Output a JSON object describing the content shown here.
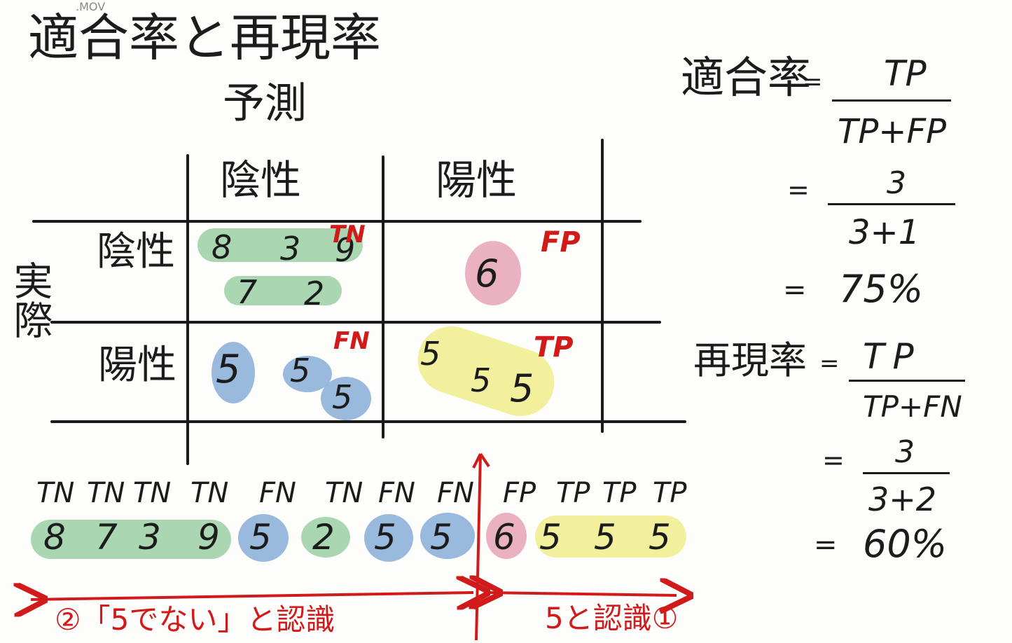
{
  "file_label": ".MOV",
  "title": "適合率と再現率",
  "predicted_header": "予測",
  "actual_header": "実際",
  "col_negative": "陰性",
  "col_positive": "陽性",
  "row_negative": "陰性",
  "row_positive": "陽性",
  "cells": {
    "tn": {
      "tag": "TN",
      "top": [
        "8",
        "3",
        "9"
      ],
      "bottom": [
        "7",
        "2"
      ]
    },
    "fp": {
      "tag": "FP",
      "values": [
        "6"
      ]
    },
    "fn": {
      "tag": "FN",
      "values": [
        "5",
        "5",
        "5"
      ]
    },
    "tp": {
      "tag": "TP",
      "values": [
        "5",
        "5",
        "5"
      ]
    }
  },
  "sequence": {
    "labels": [
      "TN",
      "TN",
      "TN",
      "TN",
      "FN",
      "TN",
      "FN",
      "FN",
      "FP",
      "TP",
      "TP",
      "TP"
    ],
    "digits": [
      "8",
      "7",
      "3",
      "9",
      "5",
      "2",
      "5",
      "5",
      "6",
      "5",
      "5",
      "5"
    ]
  },
  "arrows": {
    "left_label": "②「5でない」と認識",
    "right_label": "5と認識①"
  },
  "precision": {
    "label": "適合率",
    "eq": "=",
    "formula_num": "TP",
    "formula_den": "TP+FP",
    "calc_num": "3",
    "calc_den": "3+1",
    "result": "75%"
  },
  "recall": {
    "label": "再現率",
    "eq": "=",
    "formula_num": "TP",
    "formula_den": "TP+FN",
    "calc_num": "3",
    "calc_den": "3+2",
    "result": "60%"
  }
}
